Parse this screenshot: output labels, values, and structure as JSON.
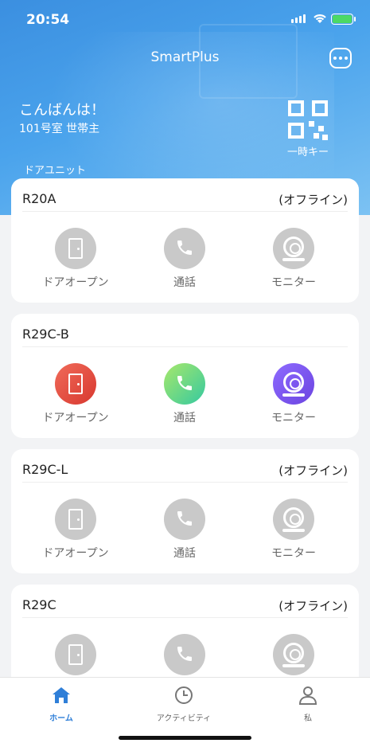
{
  "status_bar": {
    "time": "20:54"
  },
  "header": {
    "app_title": "SmartPlus",
    "greeting": "こんばんは！",
    "room": "101号室 世帯主",
    "temp_key_label": "一時キー",
    "section_label": "ドアユニット"
  },
  "actions": {
    "open": "ドアオープン",
    "call": "通話",
    "monitor": "モニター"
  },
  "units": [
    {
      "name": "R20A",
      "status": "(オフライン)",
      "online": false
    },
    {
      "name": "R29C-B",
      "status": "",
      "online": true
    },
    {
      "name": "R29C-L",
      "status": "(オフライン)",
      "online": false
    },
    {
      "name": "R29C",
      "status": "(オフライン)",
      "online": false
    }
  ],
  "tabs": [
    {
      "label": "ホーム",
      "active": true
    },
    {
      "label": "アクティビティ",
      "active": false
    },
    {
      "label": "私",
      "active": false
    }
  ],
  "colors": {
    "accent": "#2f7fd8",
    "open_online": "#e24a3c",
    "call_online": "#5fd48a",
    "monitor_online": "#7b55f0",
    "offline": "#c9c9c9"
  }
}
